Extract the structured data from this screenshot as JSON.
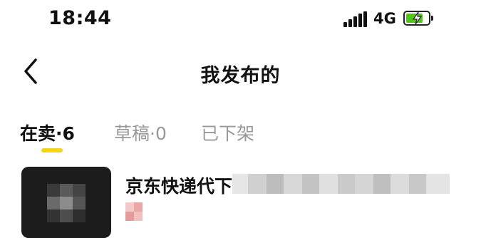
{
  "status_bar": {
    "time": "18:44",
    "network": "4G",
    "battery_color": "#52c41a"
  },
  "nav": {
    "title": "我发布的"
  },
  "tabs": [
    {
      "label": "在卖·6",
      "active": true
    },
    {
      "label": "草稿·0",
      "active": false
    },
    {
      "label": "已下架",
      "active": false
    }
  ],
  "accent_color": "#f2d51d",
  "listing": {
    "title": "京东快递代下"
  }
}
